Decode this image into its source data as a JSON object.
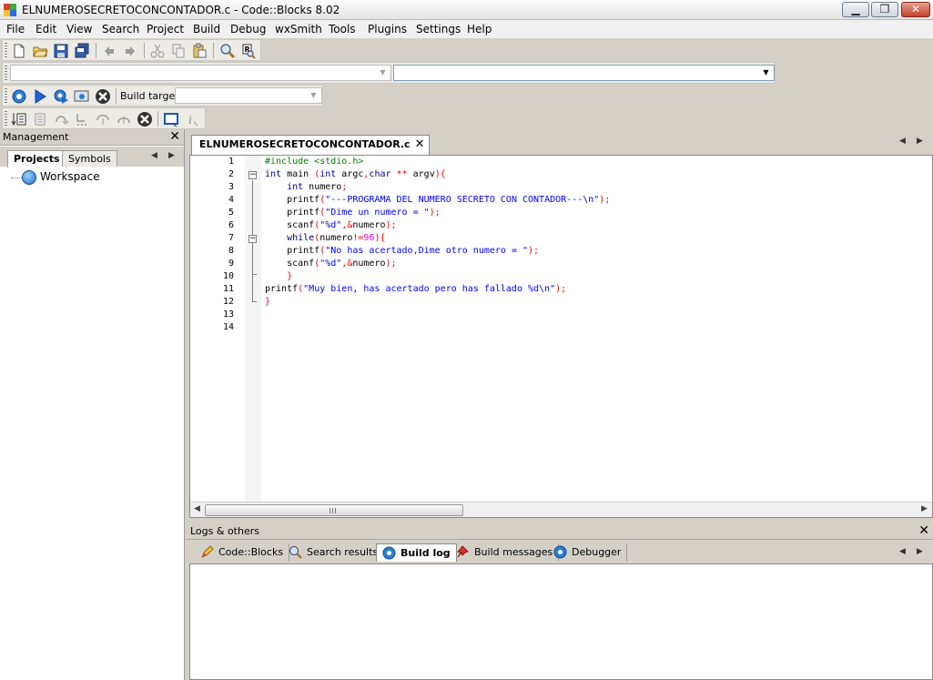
{
  "window": {
    "title": "ELNUMEROSECRETOCONCONTADOR.c - Code::Blocks 8.02",
    "minimize_glyph": "▁",
    "maximize_glyph": "❐",
    "close_glyph": "✕"
  },
  "menu": [
    "File",
    "Edit",
    "View",
    "Search",
    "Project",
    "Build",
    "Debug",
    "wxSmith",
    "Tools",
    "Plugins",
    "Settings",
    "Help"
  ],
  "compiler_toolbar": {
    "build_target_label": "Build target:",
    "build_target_value": ""
  },
  "code_completion_toolbar": {
    "scope_value": "",
    "function_value": ""
  },
  "management": {
    "title": "Management",
    "close_glyph": "✕",
    "tabs": [
      "Projects",
      "Symbols"
    ],
    "active_tab": "Projects",
    "tree": {
      "root": "Workspace"
    }
  },
  "editor": {
    "file_tab": "ELNUMEROSECRETOCONCONTADOR.c",
    "file_tab_close": "✕",
    "line_numbers": [
      "1",
      "2",
      "3",
      "4",
      "5",
      "6",
      "7",
      "8",
      "9",
      "10",
      "11",
      "12",
      "13",
      "14"
    ],
    "code_lines": [
      "#include <stdio.h>",
      "int main (int argc,char ** argv){",
      "    int numero;",
      "    printf(\"---PROGRAMA DEL NUMERO SECRETO CON CONTADOR---\\n\");",
      "    printf(\"Dime un numero = \");",
      "    scanf(\"%d\",&numero);",
      "    while(numero!=96){",
      "    printf(\"No has acertado,Dime otro numero = \");",
      "    scanf(\"%d\",&numero);",
      "    }",
      "printf(\"Muy bien, has acertado pero has fallado %d\\n\");",
      "}",
      "",
      ""
    ]
  },
  "logs": {
    "title": "Logs & others",
    "close_glyph": "✕",
    "tabs": [
      "Code::Blocks",
      "Search results",
      "Build log",
      "Build messages",
      "Debugger"
    ],
    "active_tab": "Build log",
    "icons": [
      "pencil-icon",
      "search-icon",
      "gear-icon",
      "pushpin-icon",
      "gear-icon"
    ]
  },
  "colors": {
    "keyword": "#00008b",
    "string": "#0000ff",
    "preprocessor": "#008000",
    "operator": "#ff0000",
    "number": "#f000f0"
  }
}
